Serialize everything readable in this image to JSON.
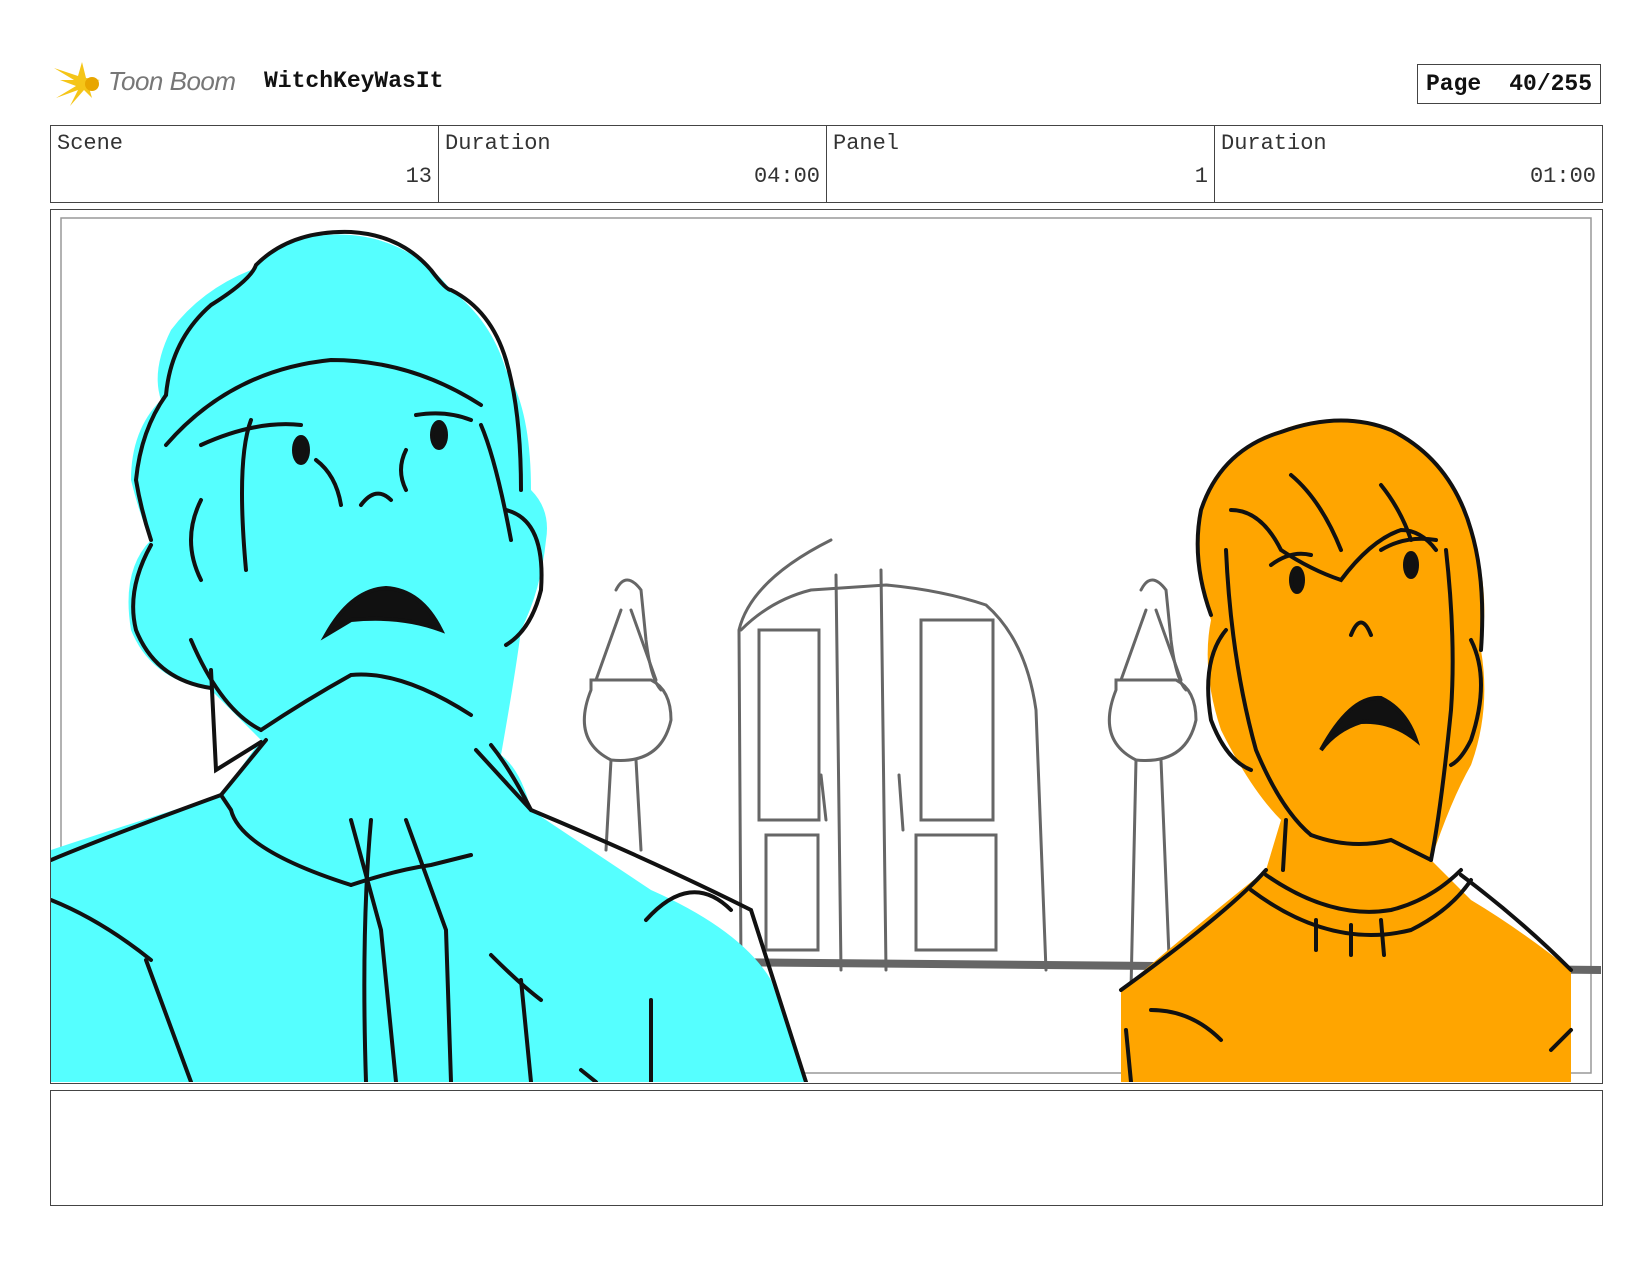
{
  "header": {
    "logo_icon": "toon-boom-star-icon",
    "brand": "Toon Boom",
    "project_title": "WitchKeyWasIt",
    "page_label": "Page",
    "page_number": "40/255"
  },
  "info": {
    "scene_label": "Scene",
    "scene_value": "13",
    "scene_duration_label": "Duration",
    "scene_duration_value": "04:00",
    "panel_label": "Panel",
    "panel_value": "1",
    "panel_duration_label": "Duration",
    "panel_duration_value": "01:00"
  },
  "colors": {
    "left_character": "#55ffff",
    "right_character": "#ffa500",
    "background_sketch": "#666666",
    "ink": "#111111"
  },
  "notes": {
    "text": ""
  }
}
